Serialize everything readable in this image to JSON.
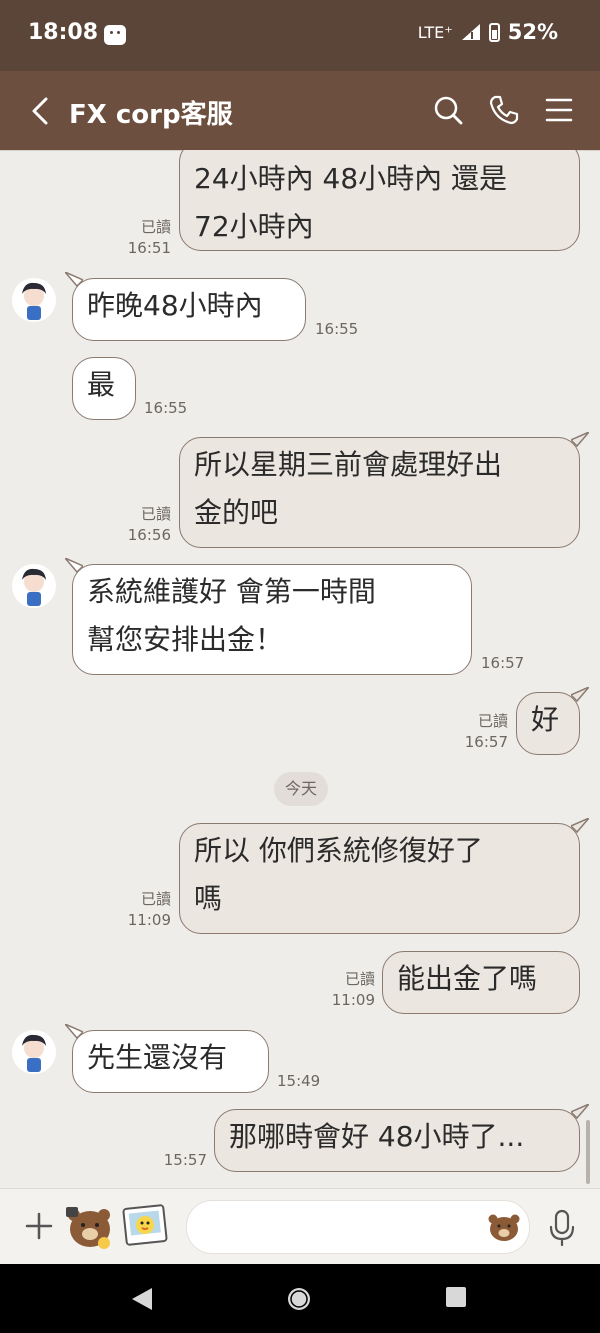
{
  "status_bar": {
    "time": "18:08",
    "network": "LTE⁺",
    "battery": "52%"
  },
  "header": {
    "title": "FX corp客服"
  },
  "date_divider": "今天",
  "messages": [
    {
      "dir": "out",
      "lines": [
        "24小時內 48小時內 還是",
        "72小時內"
      ],
      "read": "已讀",
      "time": "16:51"
    },
    {
      "dir": "in",
      "lines": [
        "昨晚48小時內"
      ],
      "time": "16:55"
    },
    {
      "dir": "in",
      "lines": [
        "最"
      ],
      "time": "16:55"
    },
    {
      "dir": "out",
      "lines": [
        "所以星期三前會處理好出",
        "金的吧"
      ],
      "read": "已讀",
      "time": "16:56"
    },
    {
      "dir": "in",
      "lines": [
        "系統維護好 會第一時間",
        "幫您安排出金！"
      ],
      "time": "16:57"
    },
    {
      "dir": "out",
      "lines": [
        "好"
      ],
      "read": "已讀",
      "time": "16:57"
    },
    {
      "dir": "out",
      "lines": [
        "所以 你們系統修復好了",
        "嗎"
      ],
      "read": "已讀",
      "time": "11:09"
    },
    {
      "dir": "out",
      "lines": [
        "能出金了嗎"
      ],
      "read": "已讀",
      "time": "11:09"
    },
    {
      "dir": "in",
      "lines": [
        "先生還沒有"
      ],
      "time": "15:49"
    },
    {
      "dir": "out",
      "lines": [
        "那哪時會好 48小時了..."
      ],
      "time": "15:57"
    }
  ],
  "icons": {
    "back": "chevron-left-icon",
    "search": "search-icon",
    "call": "phone-icon",
    "menu": "menu-icon",
    "plus": "plus-icon",
    "sticker": "sticker-icon",
    "emoji": "emoji-icon",
    "mic": "microphone-icon"
  },
  "colors": {
    "header_bg": "#6d4f3f",
    "status_bg": "#5b4539",
    "chat_bg": "#efedea",
    "out_bubble": "#ece6e0",
    "in_bubble": "#ffffff"
  }
}
